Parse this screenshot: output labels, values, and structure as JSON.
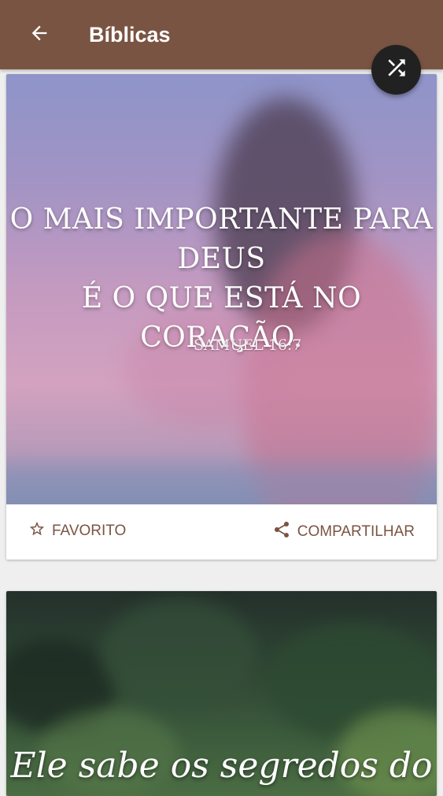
{
  "appbar": {
    "title": "Bíblicas",
    "color": "#7a5442"
  },
  "icons": {
    "back": "arrow-back-icon",
    "shuffle": "shuffle-icon",
    "favorite": "star-outline-icon",
    "share": "share-icon"
  },
  "cards": [
    {
      "quote_line1": "O MAIS IMPORTANTE PARA DEUS",
      "quote_line2": "É O QUE ESTÁ NO CORAÇÃO.",
      "reference": "SAMUEL 16:7",
      "favorite_label": "FAVORITO",
      "share_label": "COMPARTILHAR"
    },
    {
      "quote_line1": "Ele sabe os segredos do"
    }
  ]
}
